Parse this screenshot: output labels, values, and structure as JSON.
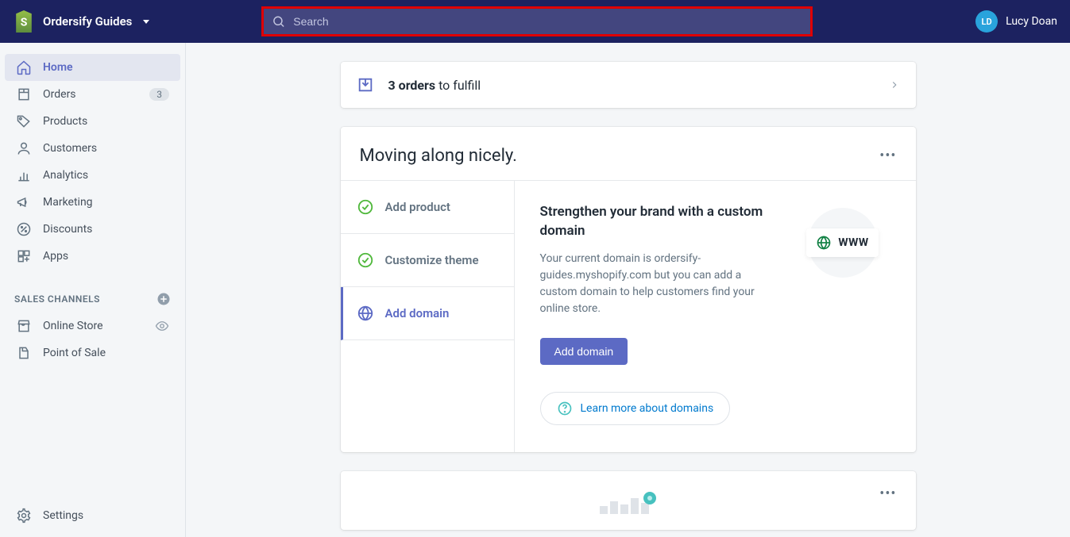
{
  "header": {
    "store_name": "Ordersify Guides",
    "search_placeholder": "Search",
    "user_initials": "LD",
    "user_name": "Lucy Doan"
  },
  "sidebar": {
    "items": [
      {
        "label": "Home"
      },
      {
        "label": "Orders",
        "badge": "3"
      },
      {
        "label": "Products"
      },
      {
        "label": "Customers"
      },
      {
        "label": "Analytics"
      },
      {
        "label": "Marketing"
      },
      {
        "label": "Discounts"
      },
      {
        "label": "Apps"
      }
    ],
    "section_title": "SALES CHANNELS",
    "channels": [
      {
        "label": "Online Store"
      },
      {
        "label": "Point of Sale"
      }
    ],
    "settings": "Settings"
  },
  "fulfill": {
    "bold": "3 orders",
    "rest": " to fulfill"
  },
  "onboarding": {
    "title": "Moving along nicely.",
    "steps": [
      {
        "label": "Add product"
      },
      {
        "label": "Customize theme"
      },
      {
        "label": "Add domain"
      }
    ],
    "domain": {
      "title": "Strengthen your brand with a custom domain",
      "desc": "Your current domain is ordersify-guides.myshopify.com but you can add a custom domain to help customers find your online store.",
      "btn": "Add domain",
      "learn": "Learn more about domains",
      "www": "WWW"
    }
  }
}
